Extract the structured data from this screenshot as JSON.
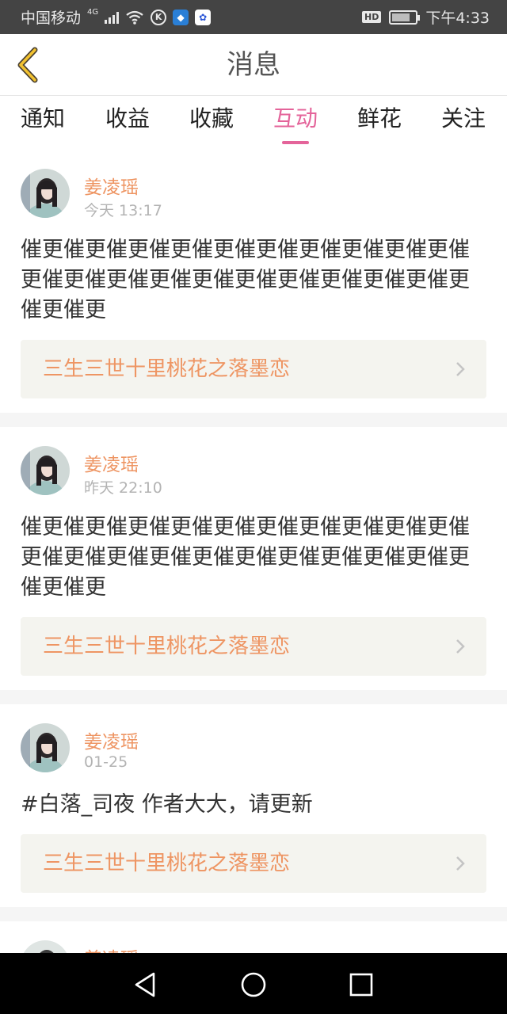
{
  "status_bar": {
    "carrier": "中国移动",
    "network": "4G",
    "time": "下午4:33",
    "hd_label": "HD"
  },
  "header": {
    "title": "消息"
  },
  "tabs": [
    {
      "label": "通知",
      "active": false
    },
    {
      "label": "收益",
      "active": false
    },
    {
      "label": "收藏",
      "active": false
    },
    {
      "label": "互动",
      "active": true
    },
    {
      "label": "鲜花",
      "active": false
    },
    {
      "label": "关注",
      "active": false
    }
  ],
  "messages": [
    {
      "username": "姜凌瑶",
      "time": "今天 13:17",
      "text": "催更催更催更催更催更催更催更催更催更催更催更催更催更催更催更催更催更催更催更催更催更催更催更",
      "book_title": "三生三世十里桃花之落墨恋"
    },
    {
      "username": "姜凌瑶",
      "time": "昨天 22:10",
      "text": "催更催更催更催更催更催更催更催更催更催更催更催更催更催更催更催更催更催更催更催更催更催更催更",
      "book_title": "三生三世十里桃花之落墨恋"
    },
    {
      "username": "姜凌瑶",
      "time": "01-25",
      "text": "#白落_司夜 作者大大，请更新",
      "book_title": "三生三世十里桃花之落墨恋"
    },
    {
      "username": "姜凌瑶",
      "time": "",
      "text": "",
      "book_title": ""
    }
  ],
  "colors": {
    "accent_pink": "#e4649a",
    "username_orange": "#ee9563",
    "status_bar_bg": "#444444"
  }
}
